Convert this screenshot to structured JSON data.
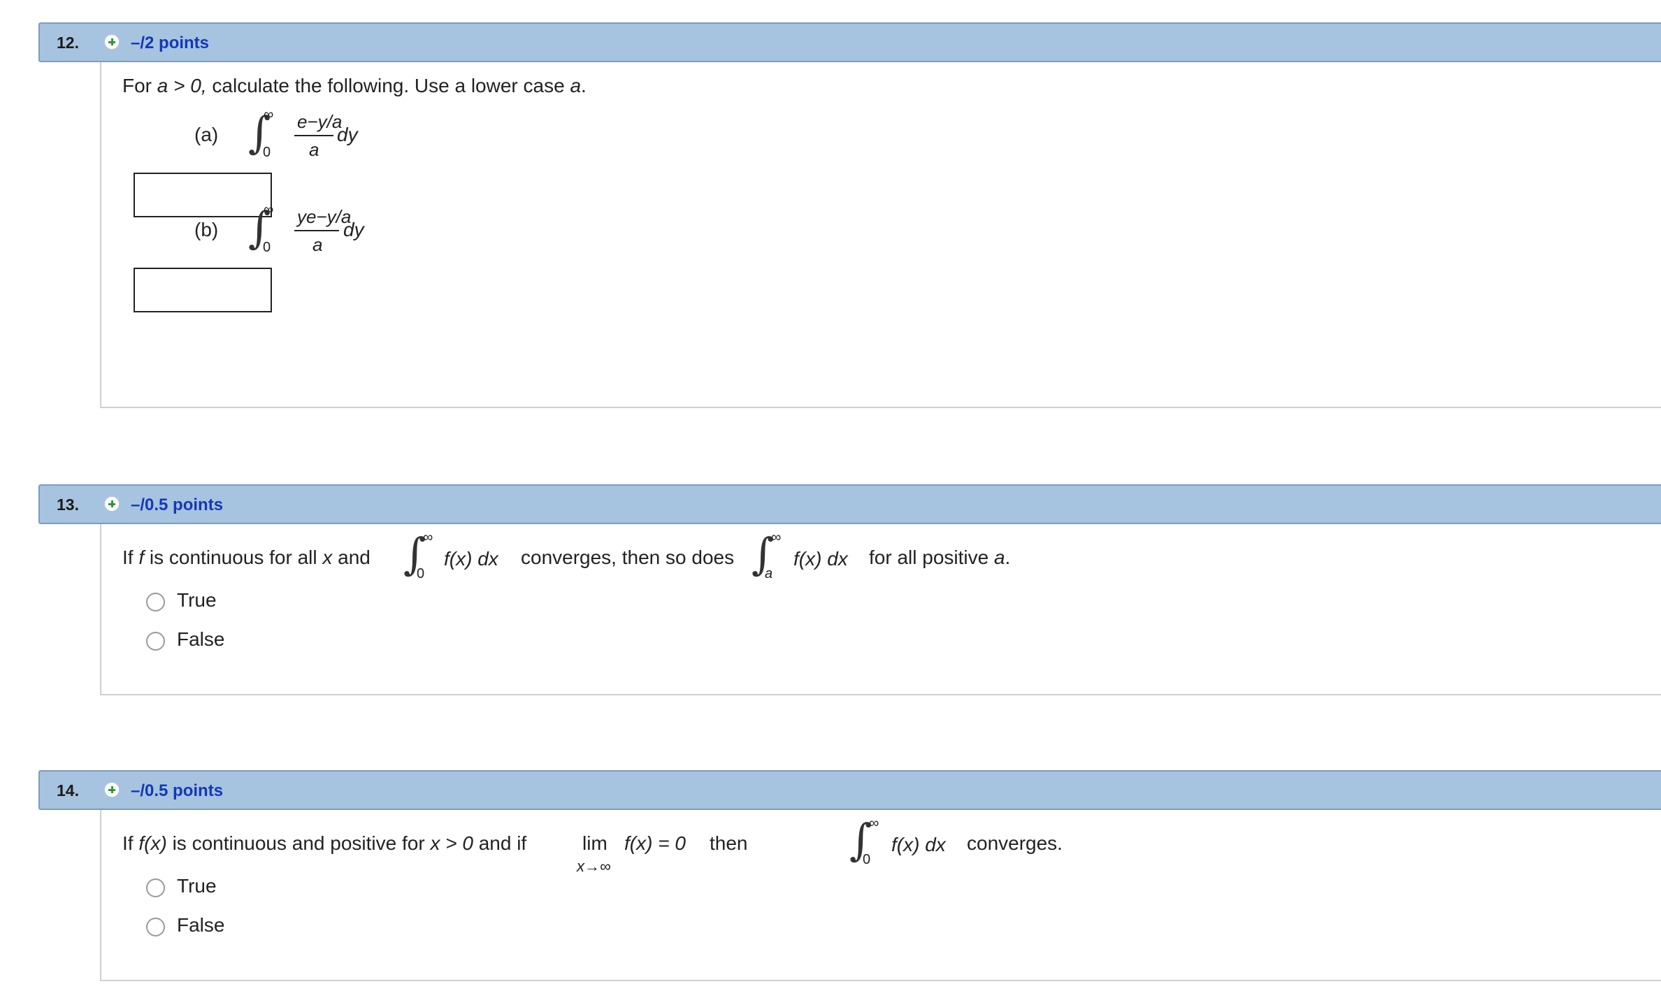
{
  "questions": [
    {
      "number": "12.",
      "points": "–/2 points",
      "prompt_for": "For",
      "prompt_cond": "a > 0,",
      "prompt_rest": "calculate the following. Use a lower case",
      "prompt_var": "a",
      "prompt_end": ".",
      "parts": [
        {
          "label": "(a)",
          "upper": "∞",
          "lower": "0",
          "numerator": "e−y/a",
          "denominator": "a",
          "dx": "dy"
        },
        {
          "label": "(b)",
          "upper": "∞",
          "lower": "0",
          "numerator": "ye−y/a",
          "denominator": "a",
          "dx": "dy"
        }
      ]
    },
    {
      "number": "13.",
      "points": "–/0.5 points",
      "t1": "If",
      "t2": "f",
      "t3": "is continuous for all",
      "t4": "x",
      "t5": "and",
      "int1_upper": "∞",
      "int1_lower": "0",
      "int1_expr": "f(x) dx",
      "t6": "converges, then so does",
      "int2_upper": "∞",
      "int2_lower": "a",
      "int2_expr": "f(x) dx",
      "t7": "for all positive",
      "t8": "a",
      "t9": ".",
      "options": [
        "True",
        "False"
      ]
    },
    {
      "number": "14.",
      "points": "–/0.5 points",
      "t1": "If",
      "t2": "f(x)",
      "t3": "is continuous and positive for",
      "t4": "x > 0",
      "t5": "and if",
      "lim_word": "lim",
      "lim_sub": "x→∞",
      "lim_expr": "f(x) = 0",
      "t6": "then",
      "int_upper": "∞",
      "int_lower": "0",
      "int_expr": "f(x) dx",
      "t7": "converges.",
      "options": [
        "True",
        "False"
      ]
    }
  ]
}
